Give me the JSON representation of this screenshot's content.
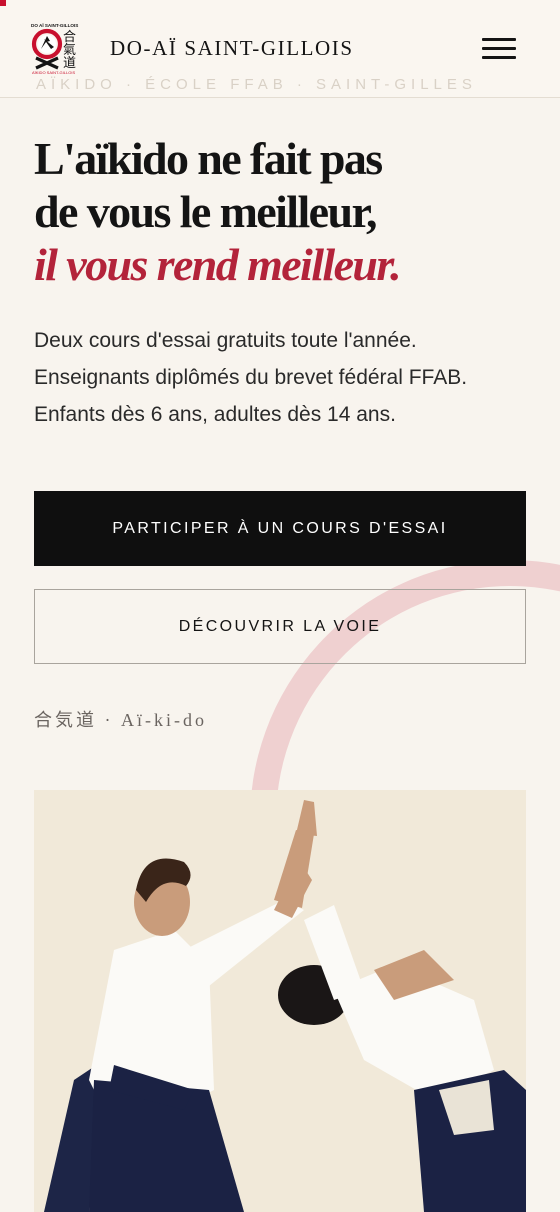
{
  "header": {
    "brand": "DO-AÏ SAINT-GILLOIS",
    "marquee": "AÏKIDO · ÉCOLE FFAB · SAINT-GILLES",
    "logo": {
      "top_text": "DO AÏ SAINT-GILLOIS",
      "kanji": "合氣道",
      "bottom_text": "AÏKIDO SAINT-GILLOIS",
      "icon": "club-logo"
    },
    "menu_icon": "hamburger-menu-icon"
  },
  "hero": {
    "headline_line1": "L'aïkido ne fait pas",
    "headline_line2": "de vous le meilleur,",
    "headline_accent": "il vous rend meilleur.",
    "intro": "Deux cours d'essai gratuits toute l'année. Enseignants diplômés du brevet fédéral FFAB. Enfants dès 6 ans, adultes dès 14 ans.",
    "cta_primary": "PARTICIPER À UN COURS D'ESSAI",
    "cta_secondary": "DÉCOUVRIR LA VOIE",
    "kanji_caption": "合気道 · Aï-ki-do"
  },
  "photo": {
    "icon": "aikido-practitioners-photo"
  },
  "colors": {
    "accent": "#b3233a",
    "background": "#f8f4ee",
    "primary_button": "#0f0f0f",
    "photo_background": "#f1e9d9"
  }
}
